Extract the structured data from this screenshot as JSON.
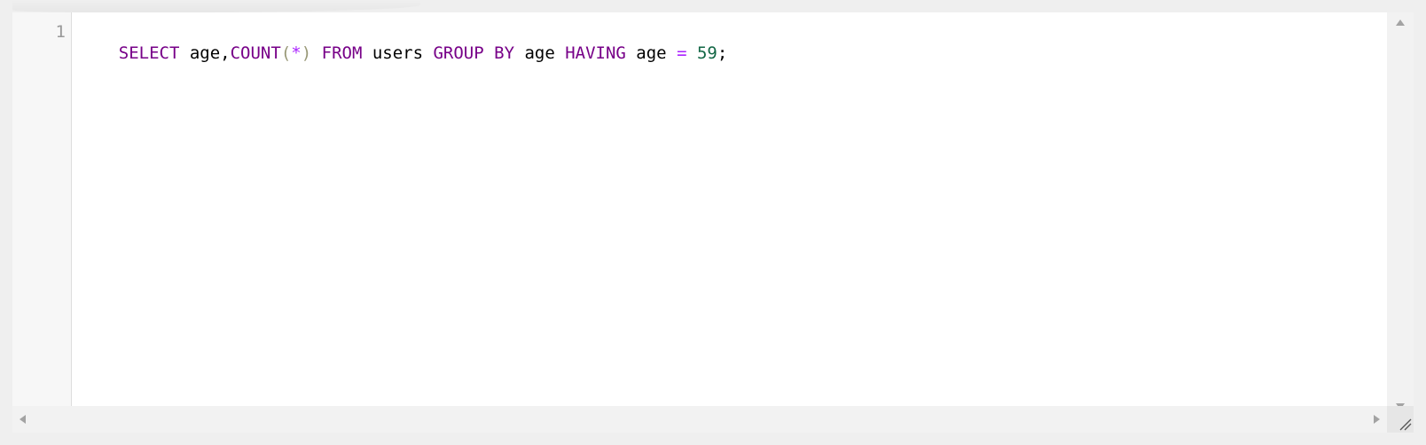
{
  "editor": {
    "line_numbers": [
      "1"
    ],
    "code_tokens": [
      {
        "text": "SELECT",
        "kind": "kw"
      },
      {
        "text": " age,",
        "kind": "plain"
      },
      {
        "text": "COUNT",
        "kind": "fn"
      },
      {
        "text": "(",
        "kind": "br"
      },
      {
        "text": "*",
        "kind": "op"
      },
      {
        "text": ")",
        "kind": "br"
      },
      {
        "text": " ",
        "kind": "plain"
      },
      {
        "text": "FROM",
        "kind": "kw"
      },
      {
        "text": " users ",
        "kind": "plain"
      },
      {
        "text": "GROUP",
        "kind": "kw"
      },
      {
        "text": " ",
        "kind": "plain"
      },
      {
        "text": "BY",
        "kind": "kw"
      },
      {
        "text": " age ",
        "kind": "plain"
      },
      {
        "text": "HAVING",
        "kind": "kw"
      },
      {
        "text": " age ",
        "kind": "plain"
      },
      {
        "text": "=",
        "kind": "op"
      },
      {
        "text": " ",
        "kind": "plain"
      },
      {
        "text": "59",
        "kind": "num"
      },
      {
        "text": ";",
        "kind": "plain"
      }
    ],
    "colors": {
      "keyword": "#770088",
      "bracket": "#999977",
      "operator": "#aa22ff",
      "number": "#116644",
      "gutter_background": "#f7f7f7",
      "line_number": "#999999"
    },
    "icons": {
      "scroll_up": "triangle-up-icon",
      "scroll_down": "triangle-down-icon",
      "scroll_left": "triangle-left-icon",
      "scroll_right": "triangle-right-icon",
      "resize": "resize-grip-icon"
    }
  }
}
